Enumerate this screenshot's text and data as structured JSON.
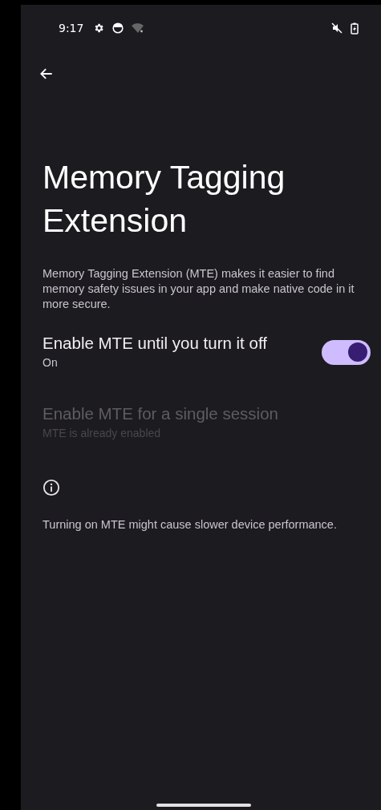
{
  "status_bar": {
    "time": "9:17"
  },
  "title": "Memory Tagging Extension",
  "description": "Memory Tagging Extension (MTE) makes it easier to find memory safety issues in your app and make native code in it more secure.",
  "settings": [
    {
      "kind": "switch",
      "title": "Enable MTE until you turn it off",
      "summary": "On",
      "on": true,
      "disabled": false
    },
    {
      "kind": "plain",
      "title": "Enable MTE for a single session",
      "summary": "MTE is already enabled",
      "disabled": true
    }
  ],
  "footer": "Turning on MTE might cause slower device performance."
}
